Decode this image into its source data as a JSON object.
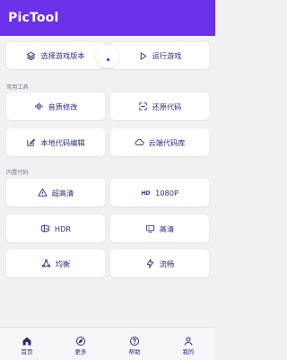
{
  "app": {
    "title": "PicTool"
  },
  "top_actions": [
    {
      "label": "选择游戏版本",
      "icon": "layers-icon"
    },
    {
      "label": "运行游戏",
      "icon": "play-icon"
    }
  ],
  "sections": {
    "common_tools": "常用工具",
    "builtin_code": "内置代码"
  },
  "common_tools": [
    {
      "label": "音质修改",
      "icon": "audio-wave-icon"
    },
    {
      "label": "还原代码",
      "icon": "restore-icon"
    },
    {
      "label": "本地代码编辑",
      "icon": "edit-icon"
    },
    {
      "label": "云端代码库",
      "icon": "cloud-icon"
    }
  ],
  "builtin_code": [
    {
      "label": "超高清",
      "icon": "warning-triangle-icon"
    },
    {
      "label": "1080P",
      "icon": "hd-icon"
    },
    {
      "label": "HDR",
      "icon": "hdr-icon"
    },
    {
      "label": "高清",
      "icon": "screen-icon"
    },
    {
      "label": "均衡",
      "icon": "network-icon"
    },
    {
      "label": "流畅",
      "icon": "lightning-icon"
    }
  ],
  "bottom_nav": [
    {
      "label": "首页",
      "icon": "home-icon"
    },
    {
      "label": "更多",
      "icon": "compass-icon"
    },
    {
      "label": "帮助",
      "icon": "help-icon"
    },
    {
      "label": "我的",
      "icon": "person-icon"
    }
  ],
  "colors": {
    "primary": "#6a31e8",
    "text": "#2b2f7a",
    "background": "#f1f1f4",
    "card": "#ffffff"
  }
}
